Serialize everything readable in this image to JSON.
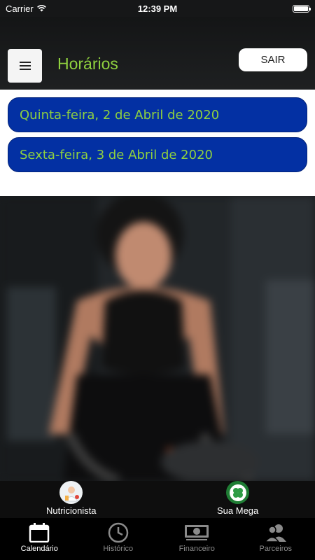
{
  "status_bar": {
    "carrier": "Carrier",
    "time": "12:39 PM"
  },
  "header": {
    "title": "Horários",
    "logout_label": "SAIR"
  },
  "dates": [
    {
      "label": "Quinta-feira, 2 de Abril de 2020"
    },
    {
      "label": "Sexta-feira, 3 de Abril de 2020"
    }
  ],
  "quick_links": [
    {
      "label": "Nutricionista",
      "icon": "nutritionist-icon"
    },
    {
      "label": "Sua Mega",
      "icon": "clover-icon"
    }
  ],
  "tabs": [
    {
      "label": "Calendário",
      "icon": "calendar-icon",
      "active": true
    },
    {
      "label": "Histórico",
      "icon": "clock-icon",
      "active": false
    },
    {
      "label": "Financeiro",
      "icon": "money-icon",
      "active": false
    },
    {
      "label": "Parceiros",
      "icon": "people-icon",
      "active": false
    }
  ],
  "colors": {
    "accent_green": "#8fd13f",
    "date_blue": "#0330a3",
    "header_bg": "#1a1b1c"
  }
}
